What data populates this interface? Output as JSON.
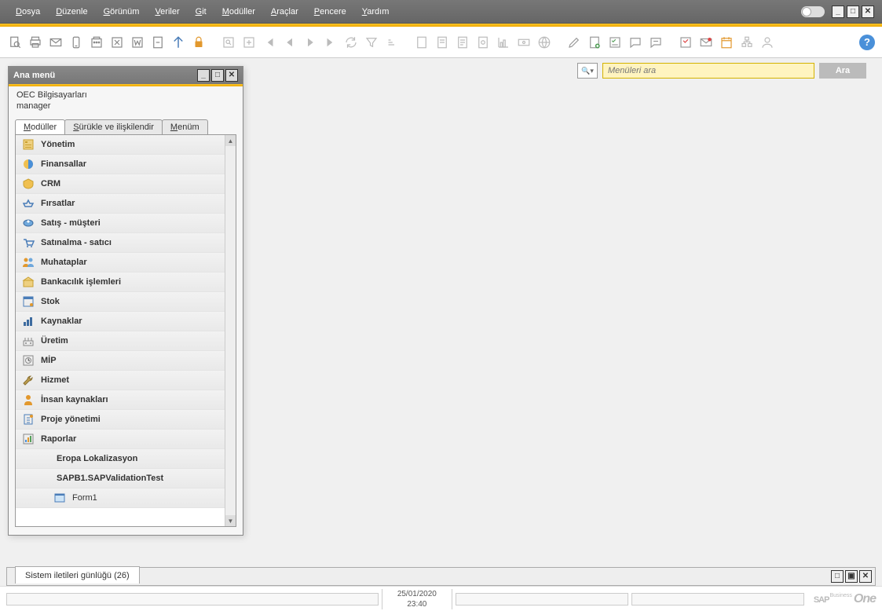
{
  "menubar": {
    "items": [
      {
        "label": "Dosya",
        "ul": "D",
        "rest": "osya"
      },
      {
        "label": "Düzenle",
        "ul": "D",
        "rest": "üzenle"
      },
      {
        "label": "Görünüm",
        "ul": "G",
        "rest": "örünüm"
      },
      {
        "label": "Veriler",
        "ul": "V",
        "rest": "eriler"
      },
      {
        "label": "Git",
        "ul": "G",
        "rest": "it"
      },
      {
        "label": "Modüller",
        "ul": "M",
        "rest": "odüller"
      },
      {
        "label": "Araçlar",
        "ul": "A",
        "rest": "raçlar"
      },
      {
        "label": "Pencere",
        "ul": "P",
        "rest": "encere"
      },
      {
        "label": "Yardım",
        "ul": "Y",
        "rest": "ardım"
      }
    ]
  },
  "search": {
    "placeholder": "Menüleri ara",
    "button": "Ara"
  },
  "mainmenu": {
    "title": "Ana menü",
    "company": "OEC Bilgisayarları",
    "user": "manager",
    "tabs": {
      "modules": {
        "ul": "M",
        "rest": "odüller"
      },
      "dragdrop": {
        "ul": "S",
        "rest": "ürükle ve ilişkilendir"
      },
      "mymenu": {
        "ul": "M",
        "rest": "enüm"
      }
    },
    "tree": [
      {
        "label": "Yönetim",
        "icon": "admin",
        "level": 1
      },
      {
        "label": "Finansallar",
        "icon": "financials",
        "level": 1
      },
      {
        "label": "CRM",
        "icon": "crm",
        "level": 1
      },
      {
        "label": "Fırsatlar",
        "icon": "opportunities",
        "level": 1
      },
      {
        "label": "Satış - müşteri",
        "icon": "sales",
        "level": 1
      },
      {
        "label": "Satınalma - satıcı",
        "icon": "purchasing",
        "level": 1
      },
      {
        "label": "Muhataplar",
        "icon": "bp",
        "level": 1
      },
      {
        "label": "Bankacılık işlemleri",
        "icon": "banking",
        "level": 1
      },
      {
        "label": "Stok",
        "icon": "inventory",
        "level": 1
      },
      {
        "label": "Kaynaklar",
        "icon": "resources",
        "level": 1
      },
      {
        "label": "Üretim",
        "icon": "production",
        "level": 1
      },
      {
        "label": "MİP",
        "icon": "mrp",
        "level": 1
      },
      {
        "label": "Hizmet",
        "icon": "service",
        "level": 1
      },
      {
        "label": "İnsan kaynakları",
        "icon": "hr",
        "level": 1
      },
      {
        "label": "Proje yönetimi",
        "icon": "project",
        "level": 1
      },
      {
        "label": "Raporlar",
        "icon": "reports",
        "level": 1
      },
      {
        "label": "Eropa Lokalizasyon",
        "icon": "",
        "level": 2
      },
      {
        "label": "SAPB1.SAPValidationTest",
        "icon": "",
        "level": 2
      },
      {
        "label": "Form1",
        "icon": "form",
        "level": 3
      }
    ]
  },
  "bottom": {
    "log_tab": "Sistem iletileri günlüğü (26)"
  },
  "status": {
    "date": "25/01/2020",
    "time": "23:40",
    "brand1": "SAP",
    "brand2": "Business",
    "brand3": "One"
  }
}
